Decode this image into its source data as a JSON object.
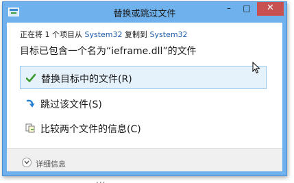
{
  "window": {
    "title": "替换或跳过文件",
    "minimize_glyph": "–",
    "maximize_glyph": "□",
    "close_glyph": "✕"
  },
  "copy_info": {
    "prefix": "正在将 1 个项目从 ",
    "source": "System32",
    "middle": " 复制到 ",
    "destination": "System32"
  },
  "message": "目标已包含一个名为“ieframe.dll”的文件",
  "options": {
    "replace": {
      "label": "替换目标中的文件(R)",
      "icon": "green-check-icon"
    },
    "skip": {
      "label": "跳过该文件(S)",
      "icon": "blue-arrow-icon"
    },
    "compare": {
      "label": "比较两个文件的信息(C)",
      "icon": "compare-files-icon"
    }
  },
  "details": {
    "label": "详细信息",
    "icon": "chevron-down-icon"
  },
  "background_text": "...",
  "colors": {
    "titlebar": "#6fb1ec",
    "close_button": "#c75050",
    "link": "#1e5aa8",
    "hover_fill": "#e5f1fb",
    "hover_border": "#99c8ec"
  }
}
